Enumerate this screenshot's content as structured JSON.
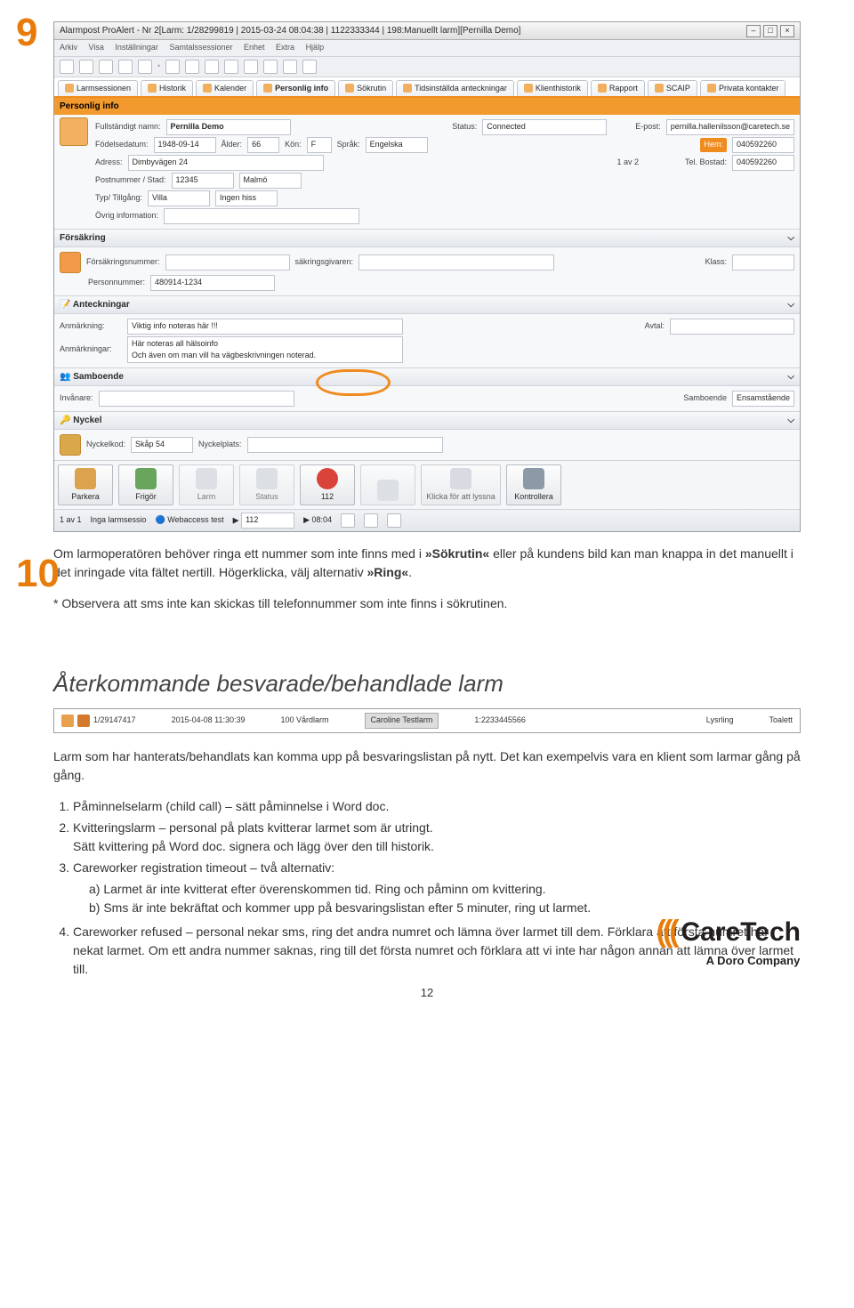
{
  "nums": {
    "n9": "9",
    "n10": "10"
  },
  "window": {
    "title": "Alarmpost ProAlert - Nr 2[Larm: 1/28299819 | 2015-03-24 08:04:38 | 1122333344 | 198:Manuellt larm][Pernilla Demo]",
    "menu": [
      "Arkiv",
      "Visa",
      "Inställningar",
      "Samtalssessioner",
      "Enhet",
      "Extra",
      "Hjälp"
    ],
    "tabs": [
      "Larmsessionen",
      "Historik",
      "Kalender",
      "Personlig info",
      "Sökrutin",
      "Tidsinställda anteckningar",
      "Klienthistorik",
      "Rapport",
      "SCAIP",
      "Privata kontakter"
    ],
    "active_tab_bar": "Personlig info"
  },
  "personal": {
    "name_lbl": "Fullständigt namn:",
    "name_val": "Pernilla Demo",
    "birth_lbl": "Födelsedatum:",
    "birth_val": "1948-09-14",
    "age_lbl": "Ålder:",
    "age_val": "66",
    "sex_lbl": "Kön:",
    "sex_val": "F",
    "lang_lbl": "Språk:",
    "lang_val": "Engelska",
    "addr_lbl": "Adress:",
    "addr_val": "Dimbyvägen 24",
    "zip_lbl": "Postnummer / Stad:",
    "zip_val": "12345",
    "city_val": "Malmö",
    "type_lbl": "Typ/ Tillgång:",
    "type_val": "Villa",
    "type2_val": "Ingen hiss",
    "misc_lbl": "Övrig information:",
    "status_lbl": "Status:",
    "status_val": "Connected",
    "email_lbl": "E-post:",
    "email_val": "pernilla.hallenilsson@caretech.se",
    "phone1_lbl": "Hem:",
    "phone1_val": "040592260",
    "count": "1 av 2",
    "phone2_lbl": "Tel. Bostad:",
    "phone2_val": "040592260"
  },
  "insurance": {
    "title": "Försäkring",
    "num_lbl": "Försäkringsnummer:",
    "giver_lbl": "säkringsgivaren:",
    "class_lbl": "Klass:",
    "pnr_lbl": "Personnummer:",
    "pnr_val": "480914-1234"
  },
  "notes": {
    "title": "Anteckningar",
    "n1_lbl": "Anmärkning:",
    "n1_val": "Viktig info noteras här !!!",
    "n2_lbl": "Anmärkningar:",
    "n2_val": "Här noteras all hälsoinfo\nOch även om man vill ha vägbeskrivningen noterad.",
    "agr_lbl": "Avtal:"
  },
  "cohab": {
    "title": "Samboende",
    "inv_lbl": "Invånare:",
    "res_lbl": "Samboende",
    "res_val": "Ensamstående"
  },
  "key": {
    "title": "Nyckel",
    "code_lbl": "Nyckelkod:",
    "code_val": "Skåp 54",
    "place_lbl": "Nyckelplats:"
  },
  "actions": {
    "park": "Parkera",
    "free": "Frigör",
    "send": "Larm",
    "call": "Status",
    "n112": "112",
    "wait": "",
    "klick": "Klicka för att lyssna",
    "ctrl": "Kontrollera"
  },
  "status": {
    "p1": "1 av 1",
    "p2": "Inga larmsessio",
    "p3": "Webaccess test",
    "p4": "112",
    "p5": "08:04"
  },
  "text9": {
    "p1a": "Om larmoperatören behöver ringa ett nummer som inte finns med i ",
    "p1b": "»Sökrutin«",
    "p1c": " eller på kundens bild kan man knappa in det manuellt i det inringade vita fältet nertill. Högerklicka, välj alternativ ",
    "p1d": "»Ring«",
    "p1e": ".",
    "p2": "* Observera att sms inte kan skickas till telefonnummer som inte finns i sökrutinen."
  },
  "section10": {
    "title": "Återkommande besvarade/behandlade larm",
    "row": {
      "id": "1/29147417",
      "ts": "2015-04-08 11:30:39",
      "unit": "100 Vårdlarm",
      "name": "Caroline Testlarm",
      "tel": "1:2233445566",
      "c5": "Lysrling",
      "c6": "Toalett"
    },
    "intro": "Larm som har hanterats/behandlats kan komma upp på besvaringslistan på nytt. Det kan exempelvis vara en klient som larmar gång på gång.",
    "items": {
      "i1": "Påminnelselarm (child call) – sätt påminnelse i Word doc.",
      "i2a": "Kvitteringslarm – personal på plats kvitterar larmet som är utringt.",
      "i2b": "Sätt kvittering på Word doc. signera och lägg över den till historik.",
      "i3a": "Careworker registration timeout – två alternativ:",
      "i3b": "a) Larmet är inte kvitterat efter överenskommen tid. Ring och påminn om kvittering.",
      "i3c": "b) Sms är inte bekräftat och kommer upp på besvaringslistan efter 5 minuter, ring ut larmet.",
      "i4": "Careworker refused – personal nekar sms, ring det andra numret och lämna över larmet till dem. Förklara att första numret har nekat larmet. Om ett andra nummer saknas, ring till det första numret och förklara att vi inte har någon annan att lämna över larmet till."
    }
  },
  "logo": {
    "marks": "(((",
    "name": "CareTech",
    "sub": "A Doro Company"
  },
  "pagenum": "12"
}
